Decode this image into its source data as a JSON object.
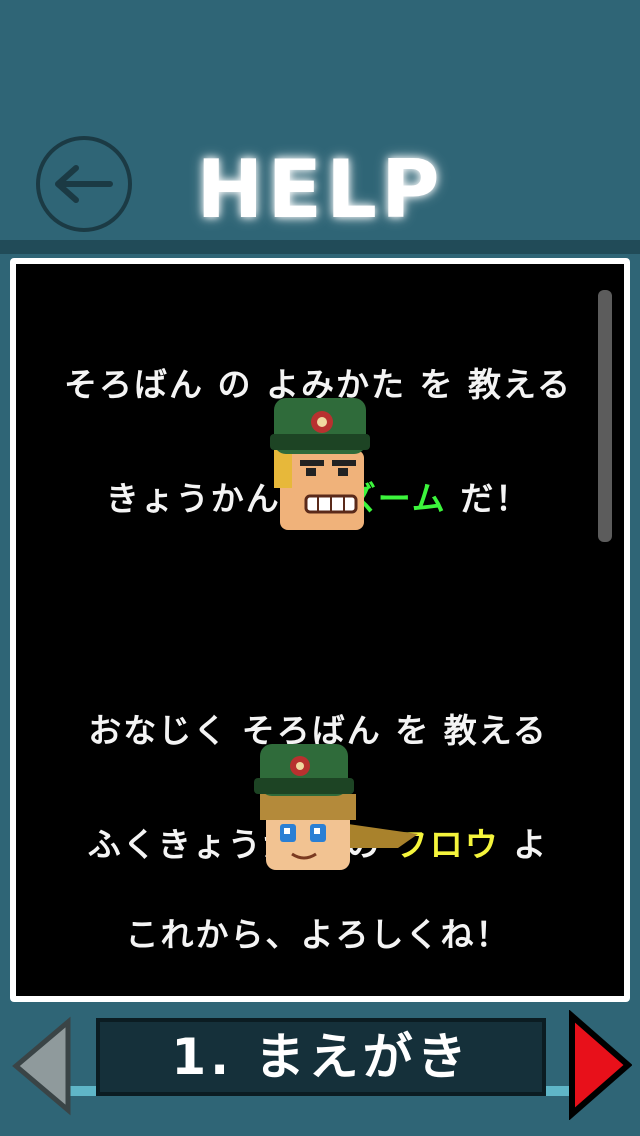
{
  "header": {
    "title": "HELP",
    "back_icon": "arrow-left-icon"
  },
  "dialog": {
    "intro_line1": "そろばん の よみかた を 教える",
    "intro_line2_pre": "きょうかん の ",
    "intro_name": "ズーム",
    "intro_line2_post": " だ！",
    "second_line1": "おなじく そろばん を 教える",
    "second_line2_pre": "ふくきょうかん の ",
    "second_name": "フロウ",
    "second_line2_post": " よ",
    "closing": "これから、よろしくね！"
  },
  "footer": {
    "chapter_label": "1. まえがき",
    "prev_icon": "arrow-left-icon",
    "next_icon": "arrow-right-icon"
  },
  "colors": {
    "name_highlight_1": "#3cf53c",
    "name_highlight_2": "#f5f53c",
    "next_arrow": "#e8101a"
  }
}
